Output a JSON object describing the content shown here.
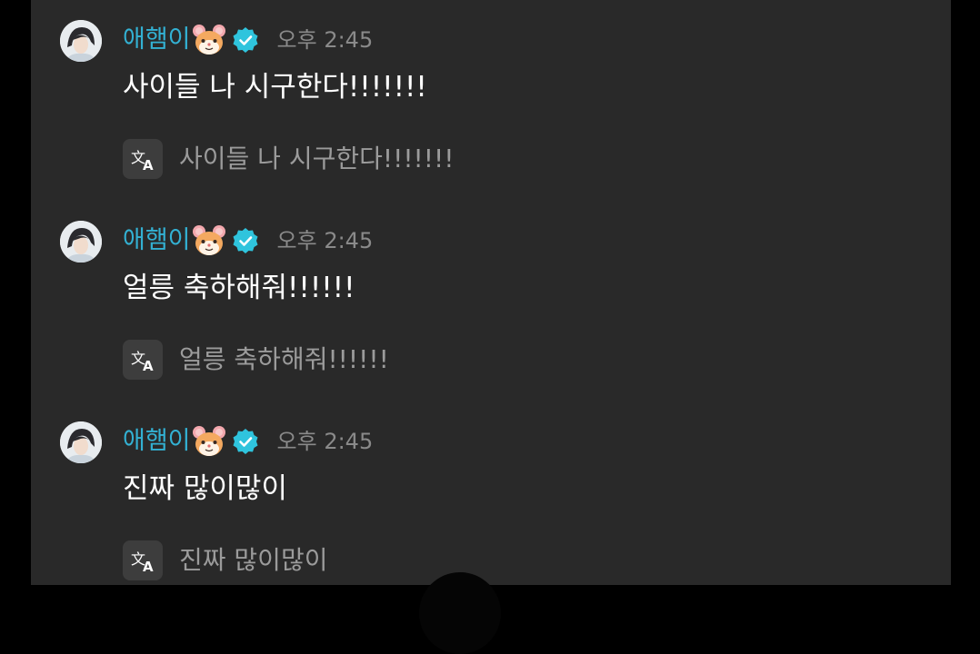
{
  "colors": {
    "background": "#000000",
    "panel": "#292929",
    "username": "#33b1d3",
    "verified": "#2fc4dd",
    "timestamp": "#8a8a8a",
    "message_text": "#ffffff",
    "translated_text": "#9b9b9b"
  },
  "messages": [
    {
      "username": "애햄이",
      "username_emoji": "hamster-face-icon",
      "verified_icon": "verified-badge-icon",
      "time": "오후 2:45",
      "text": "사이들 나 시구한다!!!!!!!",
      "translate_icon": "translate-icon",
      "translation": "사이들 나 시구한다!!!!!!!"
    },
    {
      "username": "애햄이",
      "username_emoji": "hamster-face-icon",
      "verified_icon": "verified-badge-icon",
      "time": "오후 2:45",
      "text": "얼릉 축하해줘!!!!!!",
      "translate_icon": "translate-icon",
      "translation": "얼릉 축하해줘!!!!!!"
    },
    {
      "username": "애햄이",
      "username_emoji": "hamster-face-icon",
      "verified_icon": "verified-badge-icon",
      "time": "오후 2:45",
      "text": "진짜 많이많이",
      "translate_icon": "translate-icon",
      "translation": "진짜 많이많이"
    }
  ]
}
